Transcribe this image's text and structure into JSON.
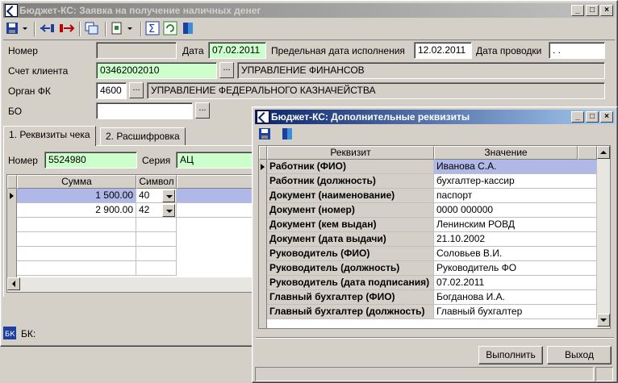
{
  "main_window": {
    "title": "Бюджет-КС: Заявка на получение наличных денег",
    "buttons": {
      "minimize": "_",
      "maximize": "□",
      "close": "×"
    },
    "fields": {
      "number_label": "Номер",
      "number_value": "",
      "date_label": "Дата",
      "date_value": "07.02.2011",
      "deadline_label": "Предельная дата исполнения",
      "deadline_value": "12.02.2011",
      "posting_date_label": "Дата проводки",
      "posting_date_value": " .  .",
      "client_account_label": "Счет клиента",
      "client_account_value": "03462002010",
      "client_account_name": "УПРАВЛЕНИЕ ФИНАНСОВ",
      "fk_label": "Орган ФК",
      "fk_code": "4600",
      "fk_name": "УПРАВЛЕНИЕ ФЕДЕРАЛЬНОГО КАЗНАЧЕЙСТВА",
      "bo_label": "БО",
      "bo_value": "",
      "dots": "..."
    },
    "tabs": [
      {
        "label": "1. Реквизиты чека",
        "active": true
      },
      {
        "label": "2. Расшифровка",
        "active": false
      }
    ],
    "cheque": {
      "number_label": "Номер",
      "number_value": "5524980",
      "series_label": "Серия",
      "series_value": "АЦ"
    },
    "table": {
      "headers": [
        "Сумма",
        "Символ"
      ],
      "rows": [
        {
          "sum": "1 500.00",
          "symbol": "40",
          "selected": true
        },
        {
          "sum": "2 900.00",
          "symbol": "42",
          "selected": false
        }
      ]
    },
    "status": {
      "label": "БК:"
    }
  },
  "dialog": {
    "title": "Бюджет-КС: Дополнительные реквизиты",
    "buttons": {
      "minimize": "_",
      "maximize": "□",
      "close": "×"
    },
    "headers": [
      "Реквизит",
      "Значение"
    ],
    "rows": [
      {
        "field": "Работник (ФИО)",
        "value": "Иванова С.А."
      },
      {
        "field": "Работник (должность)",
        "value": "бухгалтер-кассир"
      },
      {
        "field": "Документ (наименование)",
        "value": "паспорт"
      },
      {
        "field": "Документ (номер)",
        "value": "0000 000000"
      },
      {
        "field": "Документ (кем выдан)",
        "value": "Ленинским РОВД"
      },
      {
        "field": "Документ (дата выдачи)",
        "value": "21.10.2002"
      },
      {
        "field": "Руководитель (ФИО)",
        "value": "Соловьев В.И."
      },
      {
        "field": "Руководитель (должность)",
        "value": "Руководитель ФО"
      },
      {
        "field": "Руководитель (дата подписания)",
        "value": "07.02.2011"
      },
      {
        "field": "Главный бухгалтер (ФИО)",
        "value": "Богданова И.А."
      },
      {
        "field": "Главный бухгалтер (должность)",
        "value": "Главный бухгалтер"
      }
    ],
    "execute_label": "Выполнить",
    "exit_label": "Выход"
  },
  "icons": [
    "save-icon",
    "dropdown-arrow-icon",
    "import-icon",
    "export-icon",
    "copy-icon",
    "document-icon",
    "sum-icon",
    "refresh-icon",
    "book-icon"
  ],
  "colors": {
    "required_field": "#ccffcc",
    "selected_row": "#b0b8e8",
    "active_title": "#0a246a",
    "inactive_title": "#808080"
  }
}
